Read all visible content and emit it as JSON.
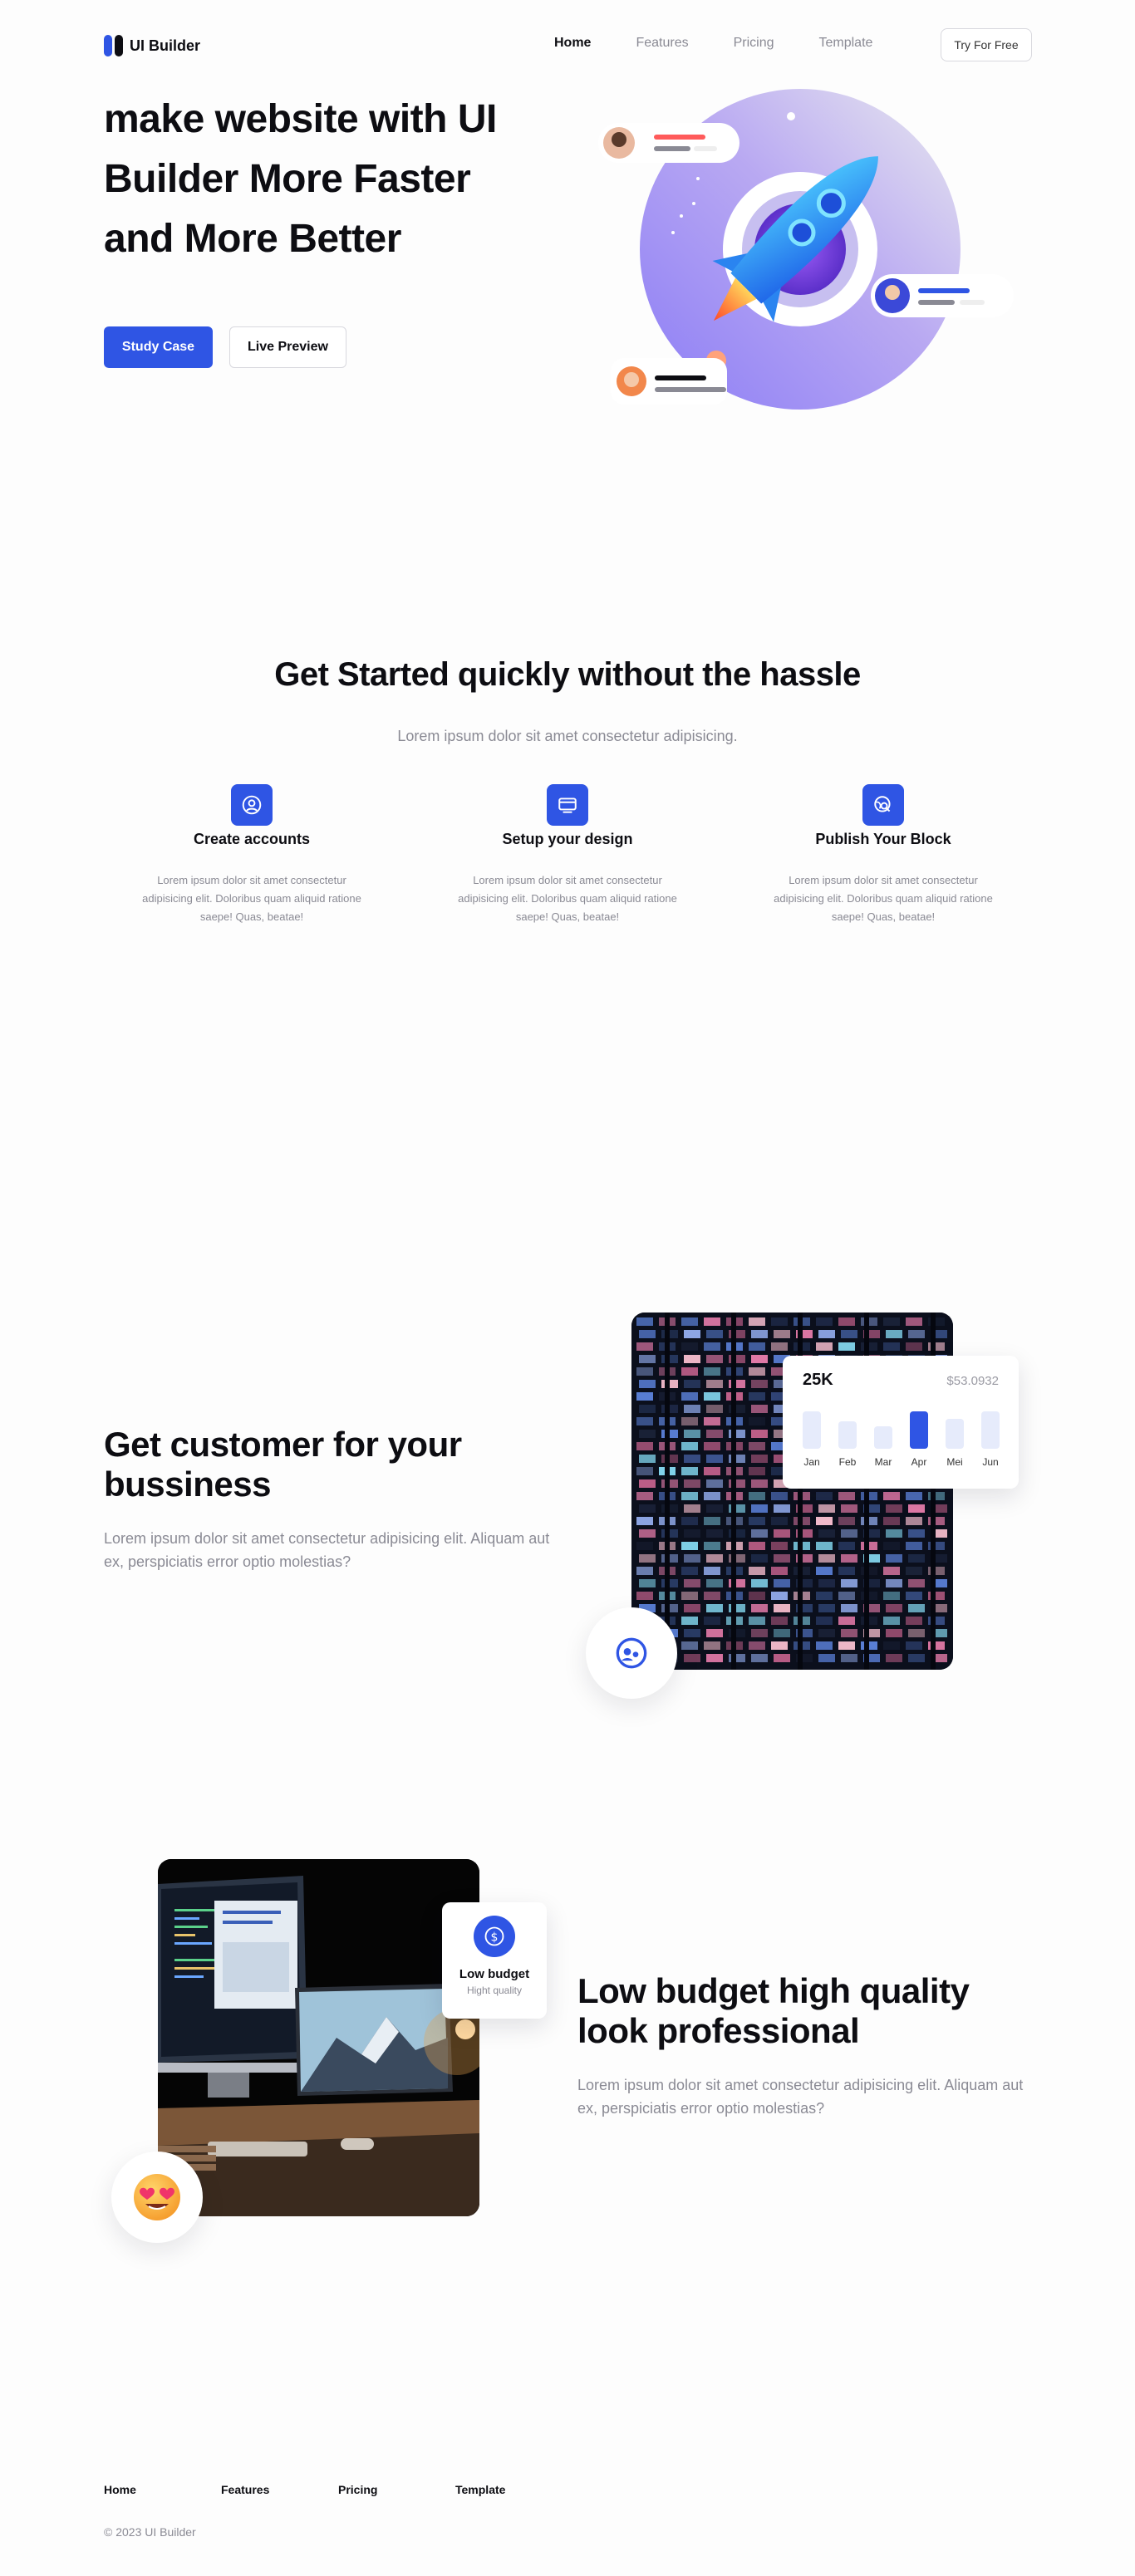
{
  "nav": {
    "brand": "UI Builder",
    "links": [
      "Home",
      "Features",
      "Pricing",
      "Template"
    ],
    "cta": "Try For Free"
  },
  "hero": {
    "title_lines": [
      "make website with UI",
      "Builder More Faster",
      "and More Better"
    ],
    "primary_button": "Study Case",
    "secondary_button": "Live Preview"
  },
  "get_started": {
    "title": "Get Started quickly without the hassle",
    "subtitle": "Lorem ipsum dolor sit amet consectetur adipisicing.",
    "features": [
      {
        "icon": "user-circle-icon",
        "title": "Create accounts",
        "desc": "Lorem ipsum dolor sit amet consectetur adipisicing elit. Doloribus quam aliquid ratione saepe! Quas, beatae!"
      },
      {
        "icon": "browser-window-icon",
        "title": "Setup your design",
        "desc": "Lorem ipsum dolor sit amet consectetur adipisicing elit. Doloribus quam aliquid ratione saepe! Quas, beatae!"
      },
      {
        "icon": "globe-search-icon",
        "title": "Publish Your Block",
        "desc": "Lorem ipsum dolor sit amet consectetur adipisicing elit. Doloribus quam aliquid ratione saepe! Quas, beatae!"
      }
    ]
  },
  "customer": {
    "title": "Get customer for your bussiness",
    "desc": "Lorem ipsum dolor sit amet consectetur adipisicing elit. Aliquam aut ex, perspiciatis error optio molestias?",
    "chart_card": {
      "headline": "25K",
      "price": "$53.0932",
      "months": [
        "Jan",
        "Feb",
        "Mar",
        "Apr",
        "Mei",
        "Jun"
      ],
      "levels": [
        0.75,
        0.55,
        0.45,
        0.75,
        0.6,
        0.75
      ],
      "highlight": "Apr"
    }
  },
  "low_budget": {
    "title": "Low budget high quality look professional",
    "desc": "Lorem ipsum dolor sit amet consectetur adipisicing elit. Aliquam aut ex, perspiciatis error optio molestias?",
    "card_title": "Low budget",
    "card_sub": "Hight quality"
  },
  "footer": {
    "links": [
      "Home",
      "Features",
      "Pricing",
      "Template"
    ],
    "copyright": "© 2023 UI Builder"
  },
  "colors": {
    "primary": "#2f55e4",
    "text": "#0d0d12",
    "muted": "#8a8a94",
    "bar_light": "#e6ebfb"
  }
}
